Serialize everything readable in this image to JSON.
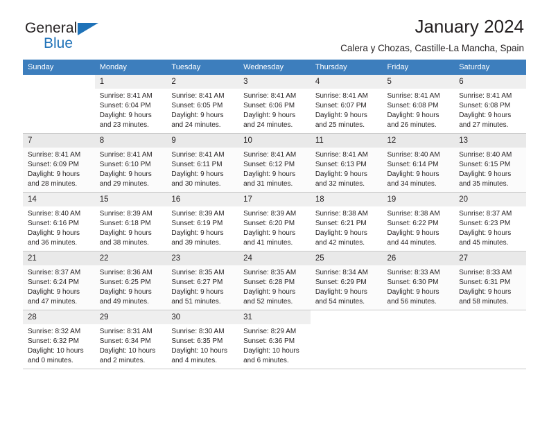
{
  "brand": {
    "line1": "General",
    "line2": "Blue",
    "flag_icon": "blue-triangle-flag",
    "accent_color": "#1f72b8"
  },
  "header": {
    "month_title": "January 2024",
    "location": "Calera y Chozas, Castille-La Mancha, Spain"
  },
  "calendar": {
    "header_bg": "#3d7ebd",
    "header_text_color": "#ffffff",
    "daynum_bg": "#efefef",
    "weekday_headers": [
      "Sunday",
      "Monday",
      "Tuesday",
      "Wednesday",
      "Thursday",
      "Friday",
      "Saturday"
    ],
    "weeks": [
      [
        {
          "day": "",
          "sunrise": "",
          "sunset": "",
          "daylight_l1": "",
          "daylight_l2": "",
          "empty": true
        },
        {
          "day": "1",
          "sunrise": "Sunrise: 8:41 AM",
          "sunset": "Sunset: 6:04 PM",
          "daylight_l1": "Daylight: 9 hours",
          "daylight_l2": "and 23 minutes.",
          "empty": false
        },
        {
          "day": "2",
          "sunrise": "Sunrise: 8:41 AM",
          "sunset": "Sunset: 6:05 PM",
          "daylight_l1": "Daylight: 9 hours",
          "daylight_l2": "and 24 minutes.",
          "empty": false
        },
        {
          "day": "3",
          "sunrise": "Sunrise: 8:41 AM",
          "sunset": "Sunset: 6:06 PM",
          "daylight_l1": "Daylight: 9 hours",
          "daylight_l2": "and 24 minutes.",
          "empty": false
        },
        {
          "day": "4",
          "sunrise": "Sunrise: 8:41 AM",
          "sunset": "Sunset: 6:07 PM",
          "daylight_l1": "Daylight: 9 hours",
          "daylight_l2": "and 25 minutes.",
          "empty": false
        },
        {
          "day": "5",
          "sunrise": "Sunrise: 8:41 AM",
          "sunset": "Sunset: 6:08 PM",
          "daylight_l1": "Daylight: 9 hours",
          "daylight_l2": "and 26 minutes.",
          "empty": false
        },
        {
          "day": "6",
          "sunrise": "Sunrise: 8:41 AM",
          "sunset": "Sunset: 6:08 PM",
          "daylight_l1": "Daylight: 9 hours",
          "daylight_l2": "and 27 minutes.",
          "empty": false
        }
      ],
      [
        {
          "day": "7",
          "sunrise": "Sunrise: 8:41 AM",
          "sunset": "Sunset: 6:09 PM",
          "daylight_l1": "Daylight: 9 hours",
          "daylight_l2": "and 28 minutes.",
          "empty": false
        },
        {
          "day": "8",
          "sunrise": "Sunrise: 8:41 AM",
          "sunset": "Sunset: 6:10 PM",
          "daylight_l1": "Daylight: 9 hours",
          "daylight_l2": "and 29 minutes.",
          "empty": false
        },
        {
          "day": "9",
          "sunrise": "Sunrise: 8:41 AM",
          "sunset": "Sunset: 6:11 PM",
          "daylight_l1": "Daylight: 9 hours",
          "daylight_l2": "and 30 minutes.",
          "empty": false
        },
        {
          "day": "10",
          "sunrise": "Sunrise: 8:41 AM",
          "sunset": "Sunset: 6:12 PM",
          "daylight_l1": "Daylight: 9 hours",
          "daylight_l2": "and 31 minutes.",
          "empty": false
        },
        {
          "day": "11",
          "sunrise": "Sunrise: 8:41 AM",
          "sunset": "Sunset: 6:13 PM",
          "daylight_l1": "Daylight: 9 hours",
          "daylight_l2": "and 32 minutes.",
          "empty": false
        },
        {
          "day": "12",
          "sunrise": "Sunrise: 8:40 AM",
          "sunset": "Sunset: 6:14 PM",
          "daylight_l1": "Daylight: 9 hours",
          "daylight_l2": "and 34 minutes.",
          "empty": false
        },
        {
          "day": "13",
          "sunrise": "Sunrise: 8:40 AM",
          "sunset": "Sunset: 6:15 PM",
          "daylight_l1": "Daylight: 9 hours",
          "daylight_l2": "and 35 minutes.",
          "empty": false
        }
      ],
      [
        {
          "day": "14",
          "sunrise": "Sunrise: 8:40 AM",
          "sunset": "Sunset: 6:16 PM",
          "daylight_l1": "Daylight: 9 hours",
          "daylight_l2": "and 36 minutes.",
          "empty": false
        },
        {
          "day": "15",
          "sunrise": "Sunrise: 8:39 AM",
          "sunset": "Sunset: 6:18 PM",
          "daylight_l1": "Daylight: 9 hours",
          "daylight_l2": "and 38 minutes.",
          "empty": false
        },
        {
          "day": "16",
          "sunrise": "Sunrise: 8:39 AM",
          "sunset": "Sunset: 6:19 PM",
          "daylight_l1": "Daylight: 9 hours",
          "daylight_l2": "and 39 minutes.",
          "empty": false
        },
        {
          "day": "17",
          "sunrise": "Sunrise: 8:39 AM",
          "sunset": "Sunset: 6:20 PM",
          "daylight_l1": "Daylight: 9 hours",
          "daylight_l2": "and 41 minutes.",
          "empty": false
        },
        {
          "day": "18",
          "sunrise": "Sunrise: 8:38 AM",
          "sunset": "Sunset: 6:21 PM",
          "daylight_l1": "Daylight: 9 hours",
          "daylight_l2": "and 42 minutes.",
          "empty": false
        },
        {
          "day": "19",
          "sunrise": "Sunrise: 8:38 AM",
          "sunset": "Sunset: 6:22 PM",
          "daylight_l1": "Daylight: 9 hours",
          "daylight_l2": "and 44 minutes.",
          "empty": false
        },
        {
          "day": "20",
          "sunrise": "Sunrise: 8:37 AM",
          "sunset": "Sunset: 6:23 PM",
          "daylight_l1": "Daylight: 9 hours",
          "daylight_l2": "and 45 minutes.",
          "empty": false
        }
      ],
      [
        {
          "day": "21",
          "sunrise": "Sunrise: 8:37 AM",
          "sunset": "Sunset: 6:24 PM",
          "daylight_l1": "Daylight: 9 hours",
          "daylight_l2": "and 47 minutes.",
          "empty": false
        },
        {
          "day": "22",
          "sunrise": "Sunrise: 8:36 AM",
          "sunset": "Sunset: 6:25 PM",
          "daylight_l1": "Daylight: 9 hours",
          "daylight_l2": "and 49 minutes.",
          "empty": false
        },
        {
          "day": "23",
          "sunrise": "Sunrise: 8:35 AM",
          "sunset": "Sunset: 6:27 PM",
          "daylight_l1": "Daylight: 9 hours",
          "daylight_l2": "and 51 minutes.",
          "empty": false
        },
        {
          "day": "24",
          "sunrise": "Sunrise: 8:35 AM",
          "sunset": "Sunset: 6:28 PM",
          "daylight_l1": "Daylight: 9 hours",
          "daylight_l2": "and 52 minutes.",
          "empty": false
        },
        {
          "day": "25",
          "sunrise": "Sunrise: 8:34 AM",
          "sunset": "Sunset: 6:29 PM",
          "daylight_l1": "Daylight: 9 hours",
          "daylight_l2": "and 54 minutes.",
          "empty": false
        },
        {
          "day": "26",
          "sunrise": "Sunrise: 8:33 AM",
          "sunset": "Sunset: 6:30 PM",
          "daylight_l1": "Daylight: 9 hours",
          "daylight_l2": "and 56 minutes.",
          "empty": false
        },
        {
          "day": "27",
          "sunrise": "Sunrise: 8:33 AM",
          "sunset": "Sunset: 6:31 PM",
          "daylight_l1": "Daylight: 9 hours",
          "daylight_l2": "and 58 minutes.",
          "empty": false
        }
      ],
      [
        {
          "day": "28",
          "sunrise": "Sunrise: 8:32 AM",
          "sunset": "Sunset: 6:32 PM",
          "daylight_l1": "Daylight: 10 hours",
          "daylight_l2": "and 0 minutes.",
          "empty": false
        },
        {
          "day": "29",
          "sunrise": "Sunrise: 8:31 AM",
          "sunset": "Sunset: 6:34 PM",
          "daylight_l1": "Daylight: 10 hours",
          "daylight_l2": "and 2 minutes.",
          "empty": false
        },
        {
          "day": "30",
          "sunrise": "Sunrise: 8:30 AM",
          "sunset": "Sunset: 6:35 PM",
          "daylight_l1": "Daylight: 10 hours",
          "daylight_l2": "and 4 minutes.",
          "empty": false
        },
        {
          "day": "31",
          "sunrise": "Sunrise: 8:29 AM",
          "sunset": "Sunset: 6:36 PM",
          "daylight_l1": "Daylight: 10 hours",
          "daylight_l2": "and 6 minutes.",
          "empty": false
        },
        {
          "day": "",
          "sunrise": "",
          "sunset": "",
          "daylight_l1": "",
          "daylight_l2": "",
          "empty": true
        },
        {
          "day": "",
          "sunrise": "",
          "sunset": "",
          "daylight_l1": "",
          "daylight_l2": "",
          "empty": true
        },
        {
          "day": "",
          "sunrise": "",
          "sunset": "",
          "daylight_l1": "",
          "daylight_l2": "",
          "empty": true
        }
      ]
    ]
  }
}
